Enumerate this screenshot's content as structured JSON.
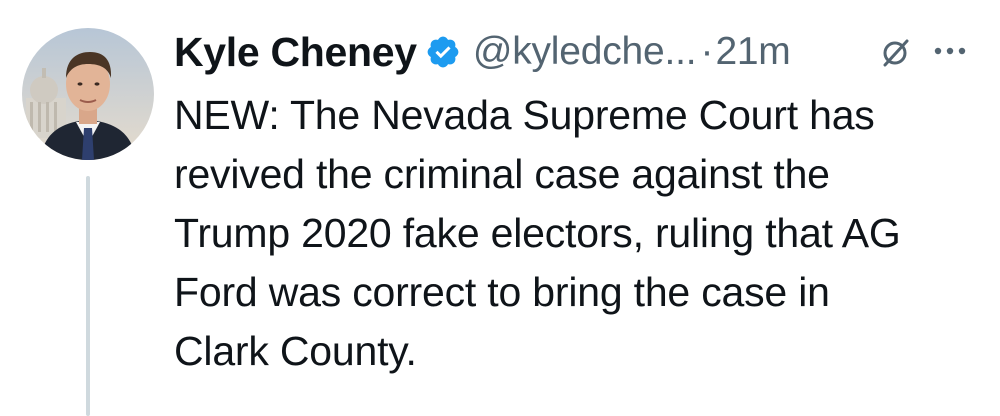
{
  "tweet": {
    "author_name": "Kyle Cheney",
    "handle": "@kyledche...",
    "separator": "·",
    "time": "21m",
    "text": "NEW: The Nevada Supreme Court has\nrevived the criminal case against the\nTrump 2020 fake electors, ruling that AG\nFord was correct to bring the case in\nClark County."
  },
  "icons": {
    "verified": "verified-badge-icon",
    "grok": "grok-icon",
    "more": "more-options-icon"
  },
  "colors": {
    "text_primary": "#0f1419",
    "text_secondary": "#536471",
    "verified_blue": "#1d9bf0",
    "thread_line": "#cfd9de"
  }
}
